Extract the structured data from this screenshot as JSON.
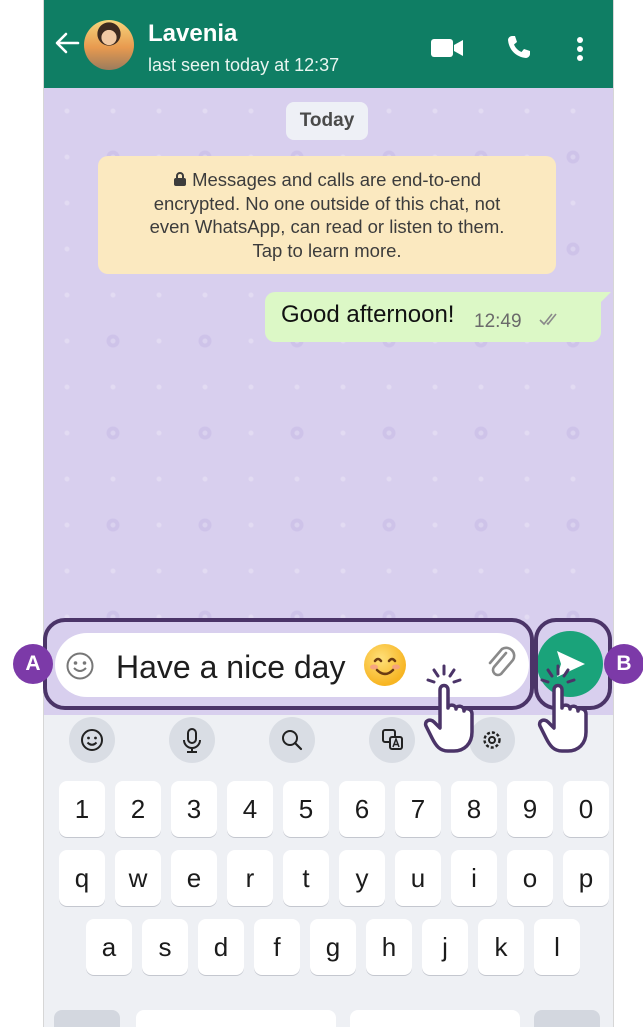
{
  "header": {
    "contact_name": "Lavenia",
    "last_seen": "last seen today at 12:37",
    "icons": [
      "back-arrow-icon",
      "video-call-icon",
      "phone-call-icon",
      "more-vert-icon"
    ]
  },
  "chat": {
    "date_label": "Today",
    "encryption_notice": [
      "Messages and calls are end-to-end",
      "encrypted. No one outside of this chat, not",
      "even WhatsApp, can read or listen to them.",
      "Tap to learn more."
    ],
    "messages": [
      {
        "text": "Good afternoon!",
        "time": "12:49",
        "status": "read"
      }
    ]
  },
  "composer": {
    "text": "Have a nice day",
    "emoji": "😊"
  },
  "keyboard": {
    "toolbar_icons": [
      "emoji-icon",
      "microphone-icon",
      "search-icon",
      "translate-icon",
      "settings-icon"
    ],
    "rows": [
      [
        "1",
        "2",
        "3",
        "4",
        "5",
        "6",
        "7",
        "8",
        "9",
        "0"
      ],
      [
        "q",
        "w",
        "e",
        "r",
        "t",
        "y",
        "u",
        "i",
        "o",
        "p"
      ],
      [
        "a",
        "s",
        "d",
        "f",
        "g",
        "h",
        "j",
        "k",
        "l"
      ]
    ]
  },
  "annotations": {
    "label_a": "A",
    "label_b": "B"
  },
  "colors": {
    "header": "#0f7e64",
    "chat_bg": "#d8cfee",
    "outgoing_bubble": "#dcf8c6",
    "notice_bg": "#fbe9c0",
    "send_button": "#1aa37a",
    "annotation": "#7c3aa8"
  }
}
